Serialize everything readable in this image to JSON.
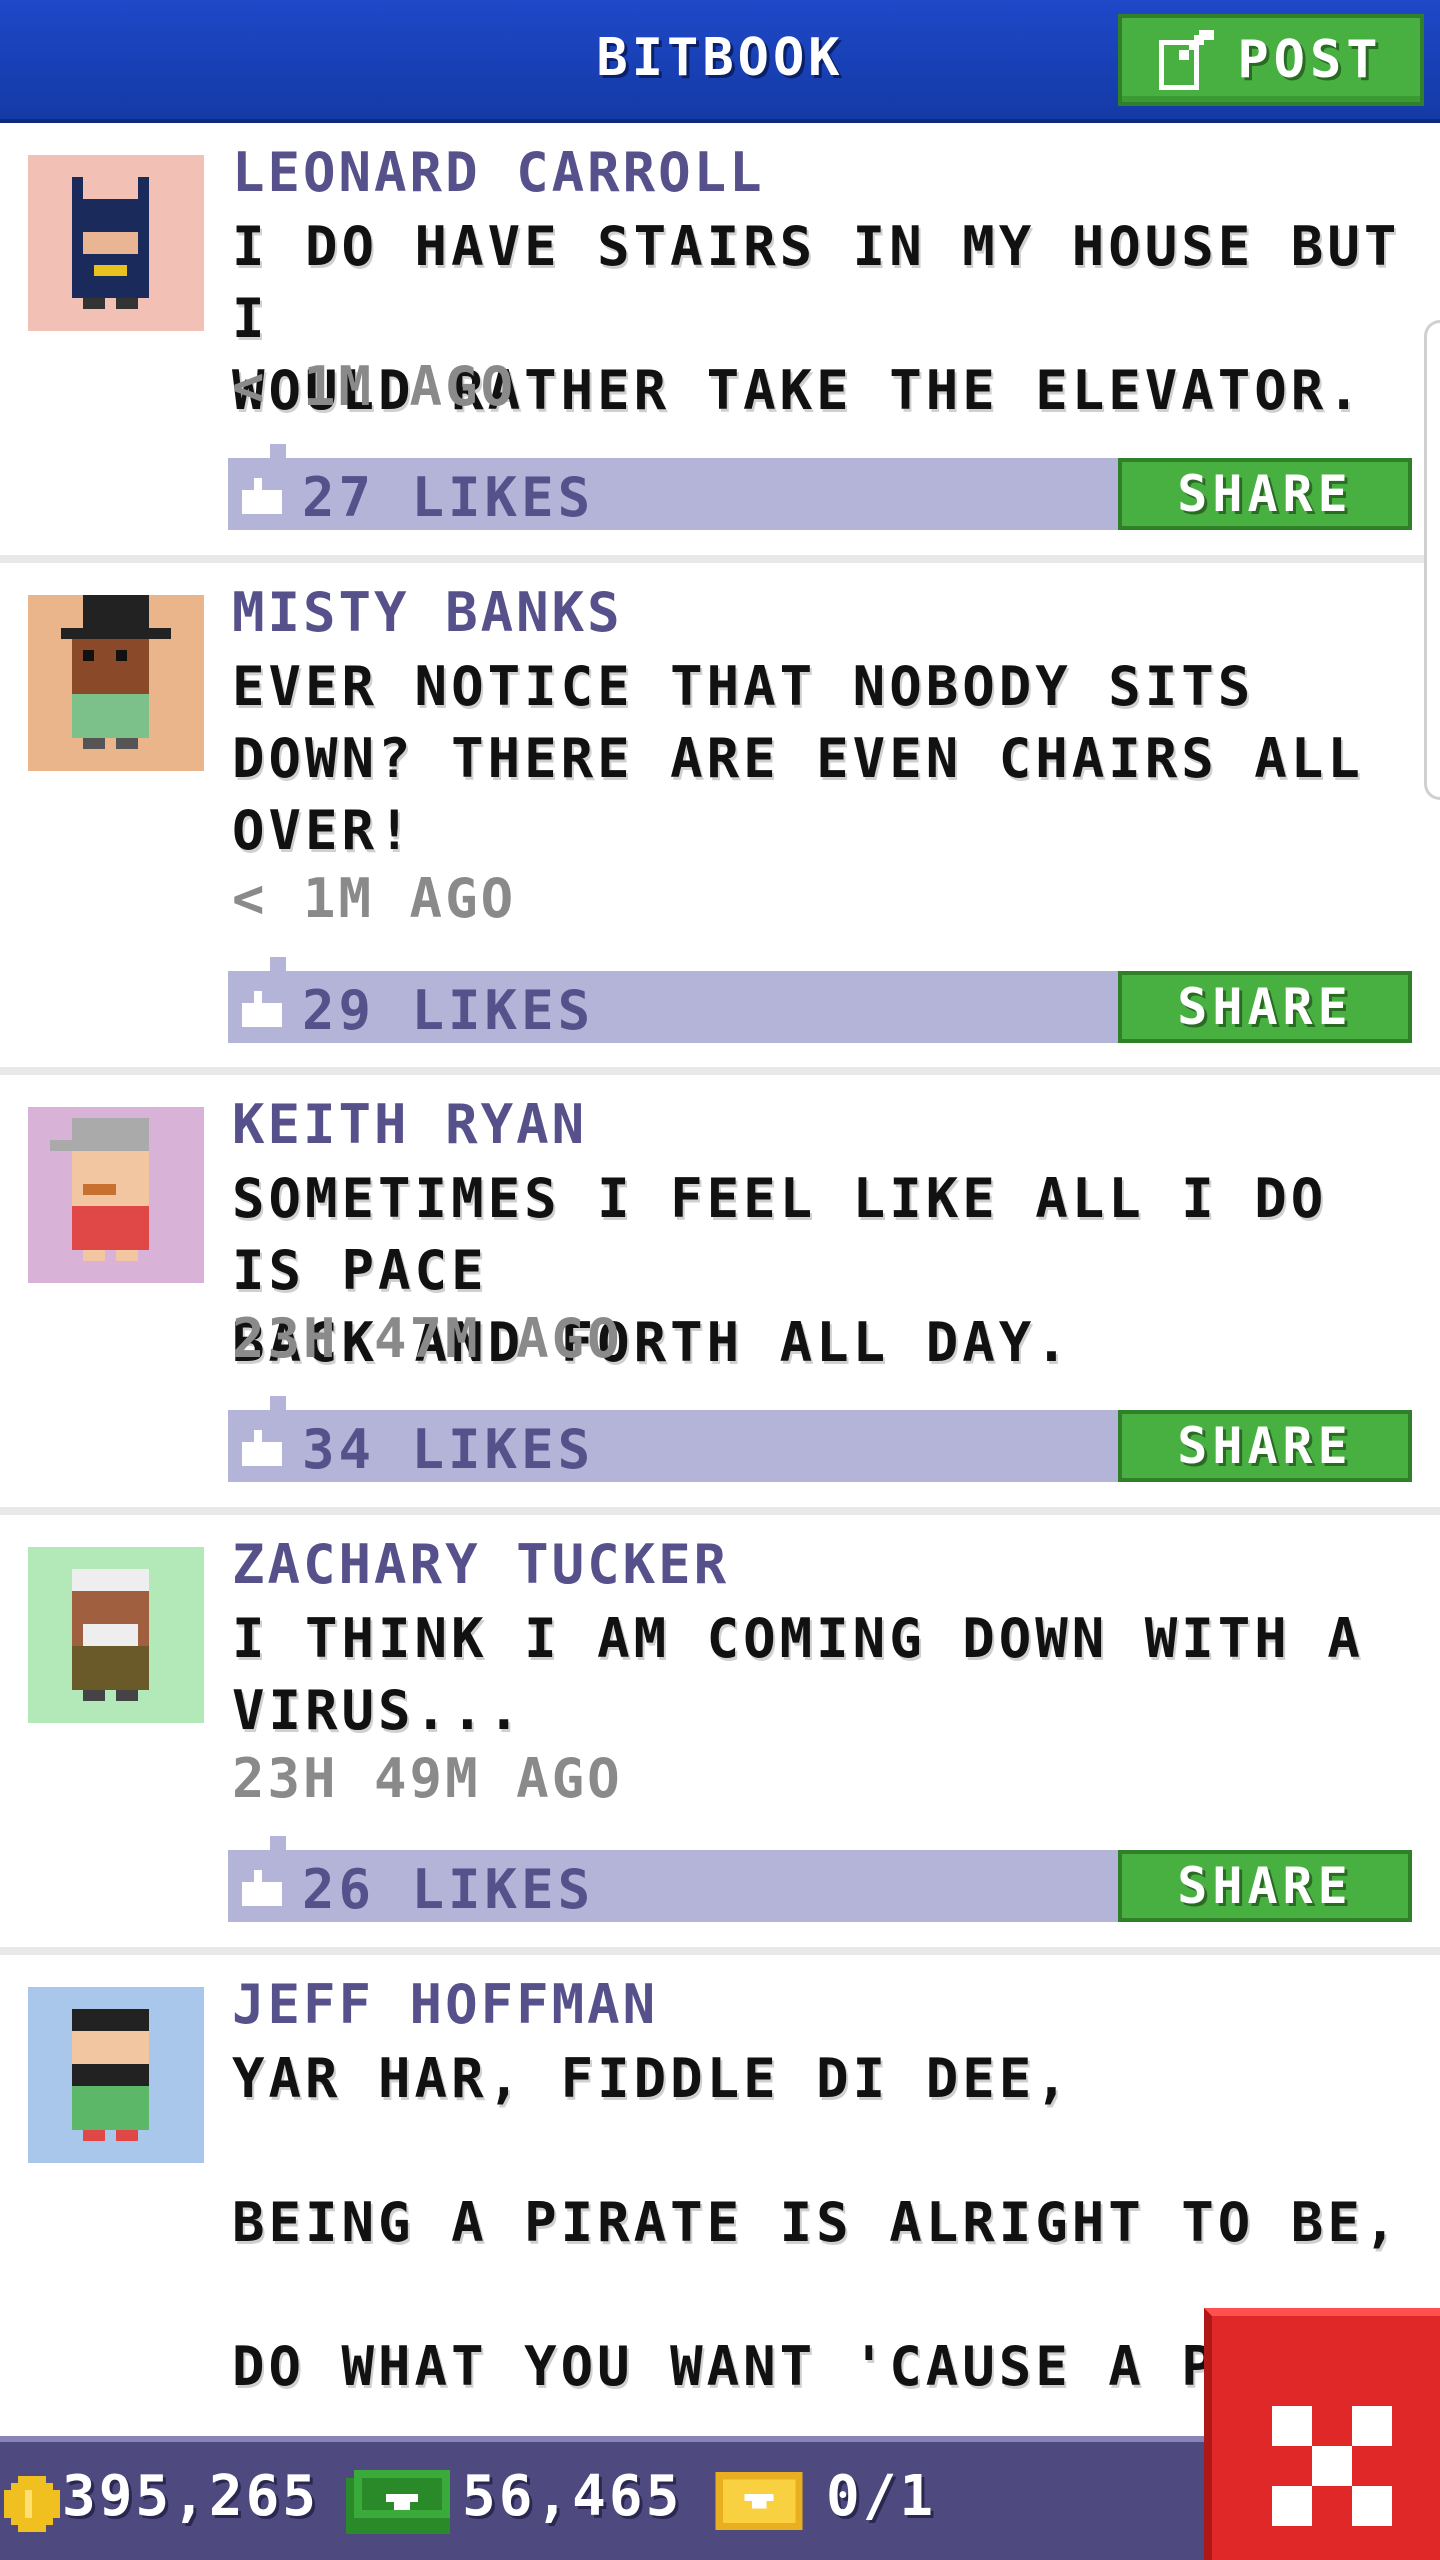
{
  "header": {
    "title": "BITBOOK",
    "post_label": "POST"
  },
  "posts": [
    {
      "name": "LEONARD CARROLL",
      "message": "I DO HAVE STAIRS IN MY HOUSE BUT I\nWOULD RATHER TAKE THE ELEVATOR.",
      "time": "< 1M AGO",
      "likes": "27 LIKES",
      "share_label": "SHARE",
      "avatar_bg": "#f2c0b4"
    },
    {
      "name": "MISTY BANKS",
      "message": "EVER NOTICE THAT NOBODY SITS\nDOWN? THERE ARE EVEN CHAIRS ALL\nOVER!",
      "time": "< 1M AGO",
      "likes": "29 LIKES",
      "share_label": "SHARE",
      "avatar_bg": "#ebb58b"
    },
    {
      "name": "KEITH RYAN",
      "message": "SOMETIMES I FEEL LIKE ALL I DO IS PACE\nBACK AND FORTH ALL DAY.",
      "time": "23H 47M AGO",
      "likes": "34 LIKES",
      "share_label": "SHARE",
      "avatar_bg": "#d9b3d7"
    },
    {
      "name": "ZACHARY TUCKER",
      "message": "I THINK I AM COMING DOWN WITH A\nVIRUS...",
      "time": "23H 49M AGO",
      "likes": "26 LIKES",
      "share_label": "SHARE",
      "avatar_bg": "#b3e8b8"
    },
    {
      "name": "JEFF HOFFMAN",
      "message": "YAR HAR, FIDDLE DI DEE,\n\nBEING A PIRATE IS ALRIGHT TO BE,\n\nDO WHAT YOU WANT 'CAUSE A P",
      "avatar_bg": "#a9c6eb"
    }
  ],
  "footer": {
    "coins": "395,265",
    "bux": "56,465",
    "tickets": "0/1"
  },
  "colors": {
    "header_blue": "#1e48c8",
    "name_purple": "#56518a",
    "share_green": "#48b040",
    "close_red": "#e02828"
  }
}
